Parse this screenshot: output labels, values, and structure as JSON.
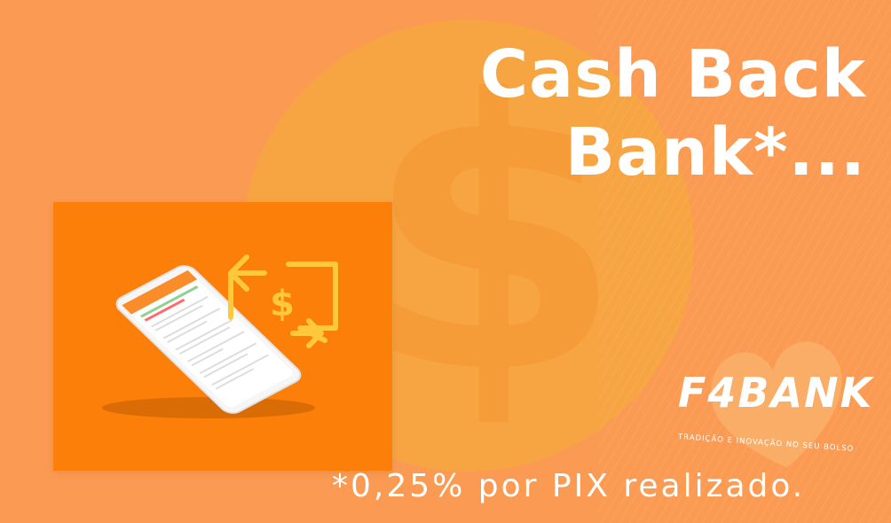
{
  "headline": {
    "line1": "Cash Back",
    "line2": "Bank*..."
  },
  "footnote": "*0,25% por PIX realizado.",
  "logo": {
    "name": "F4BANK",
    "tagline": "TRADIÇÃO E INOVAÇÃO NO SEU BOLSO"
  },
  "decor": {
    "background_symbol": "$",
    "card_symbol": "$"
  },
  "colors": {
    "background": "#fb9a52",
    "circle": "#f7a441",
    "card": "#fb7f08",
    "icon_yellow": "#ffc83d",
    "text": "#ffffff"
  }
}
